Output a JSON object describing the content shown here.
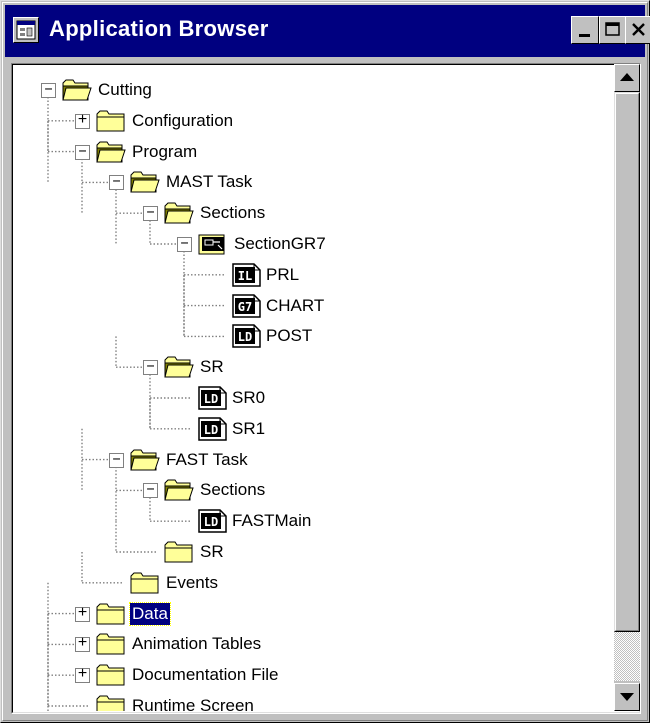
{
  "window": {
    "title": "Application Browser",
    "title_icon": "application-browser-icon",
    "buttons": [
      "minimize",
      "maximize",
      "close"
    ]
  },
  "colors": {
    "titlebar": "#000080",
    "face": "#c0c0c0",
    "folder": "#ffff99",
    "selection": "#000080"
  },
  "tree": {
    "nodes": [
      {
        "label": "Cutting",
        "icon": "folder-open-icon",
        "expander": "minus"
      },
      {
        "label": "Configuration",
        "icon": "folder-closed-icon",
        "expander": "plus"
      },
      {
        "label": "Program",
        "icon": "folder-open-icon",
        "expander": "minus"
      },
      {
        "label": "MAST Task",
        "icon": "folder-open-icon",
        "expander": "minus"
      },
      {
        "label": "Sections",
        "icon": "folder-open-icon",
        "expander": "minus"
      },
      {
        "label": "SectionGR7",
        "icon": "grafcet-section-icon",
        "expander": "minus"
      },
      {
        "label": "PRL",
        "icon": "il-section-icon",
        "badge": "IL",
        "expander": ""
      },
      {
        "label": "CHART",
        "icon": "g7-section-icon",
        "badge": "G7",
        "expander": ""
      },
      {
        "label": "POST",
        "icon": "ld-section-icon",
        "badge": "LD",
        "expander": ""
      },
      {
        "label": "SR",
        "icon": "folder-open-icon",
        "expander": "minus"
      },
      {
        "label": "SR0",
        "icon": "ld-section-icon",
        "badge": "LD",
        "expander": ""
      },
      {
        "label": "SR1",
        "icon": "ld-section-icon",
        "badge": "LD",
        "expander": ""
      },
      {
        "label": "FAST Task",
        "icon": "folder-open-icon",
        "expander": "minus"
      },
      {
        "label": "Sections",
        "icon": "folder-open-icon",
        "expander": "minus"
      },
      {
        "label": "FASTMain",
        "icon": "ld-section-icon",
        "badge": "LD",
        "expander": ""
      },
      {
        "label": "SR",
        "icon": "folder-closed-icon",
        "expander": ""
      },
      {
        "label": "Events",
        "icon": "folder-closed-icon",
        "expander": ""
      },
      {
        "label": "Data",
        "icon": "folder-closed-icon",
        "expander": "plus",
        "selected": true
      },
      {
        "label": "Animation Tables",
        "icon": "folder-closed-icon",
        "expander": "plus"
      },
      {
        "label": "Documentation File",
        "icon": "folder-closed-icon",
        "expander": "plus"
      },
      {
        "label": "Runtime Screen",
        "icon": "folder-closed-icon",
        "expander": ""
      }
    ]
  },
  "scrollbar": {
    "position_fraction": 0.0,
    "up_icon": "scroll-up-icon",
    "down_icon": "scroll-down-icon"
  }
}
